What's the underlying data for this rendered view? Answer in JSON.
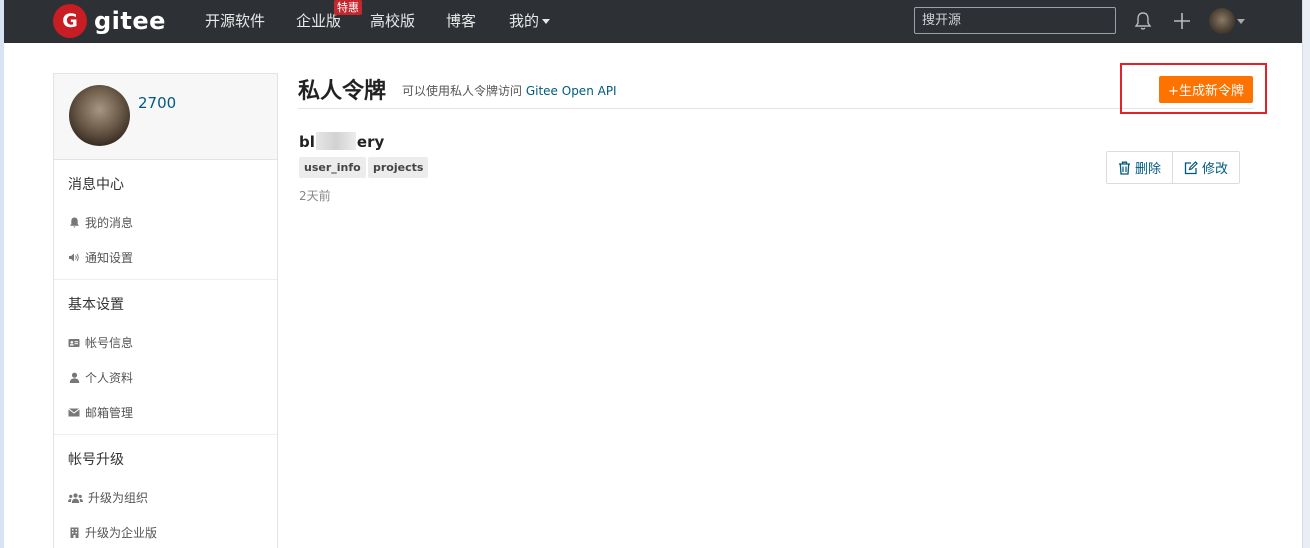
{
  "nav": {
    "logo_text": "gitee",
    "logo_letter": "G",
    "items": [
      "开源软件",
      "企业版",
      "高校版",
      "博客",
      "我的"
    ],
    "badge": "特惠",
    "search_placeholder": "搜开源"
  },
  "sidebar": {
    "username": "2700",
    "sections": [
      {
        "title": "消息中心",
        "items": [
          {
            "label": "我的消息",
            "icon": "bell-icon"
          },
          {
            "label": "通知设置",
            "icon": "speaker-icon"
          }
        ]
      },
      {
        "title": "基本设置",
        "items": [
          {
            "label": "帐号信息",
            "icon": "id-card-icon"
          },
          {
            "label": "个人资料",
            "icon": "user-icon"
          },
          {
            "label": "邮箱管理",
            "icon": "envelope-icon"
          }
        ]
      },
      {
        "title": "帐号升级",
        "items": [
          {
            "label": "升级为组织",
            "icon": "users-icon"
          },
          {
            "label": "升级为企业版",
            "icon": "building-icon"
          }
        ]
      }
    ]
  },
  "main": {
    "title": "私人令牌",
    "subtitle_prefix": "可以使用私人令牌访问 ",
    "subtitle_link": "Gitee Open API",
    "generate_button": "+生成新令牌",
    "token": {
      "name_start": "bl",
      "name_end": "ery",
      "scopes": [
        "user_info",
        "projects"
      ],
      "time": "2天前"
    },
    "delete_button": "删除",
    "edit_button": "修改"
  },
  "colors": {
    "nav_bg": "#2d3035",
    "brand_red": "#c71d23",
    "accent_orange": "#fe7300",
    "link_blue": "#005980",
    "highlight_red": "#e2222b"
  }
}
